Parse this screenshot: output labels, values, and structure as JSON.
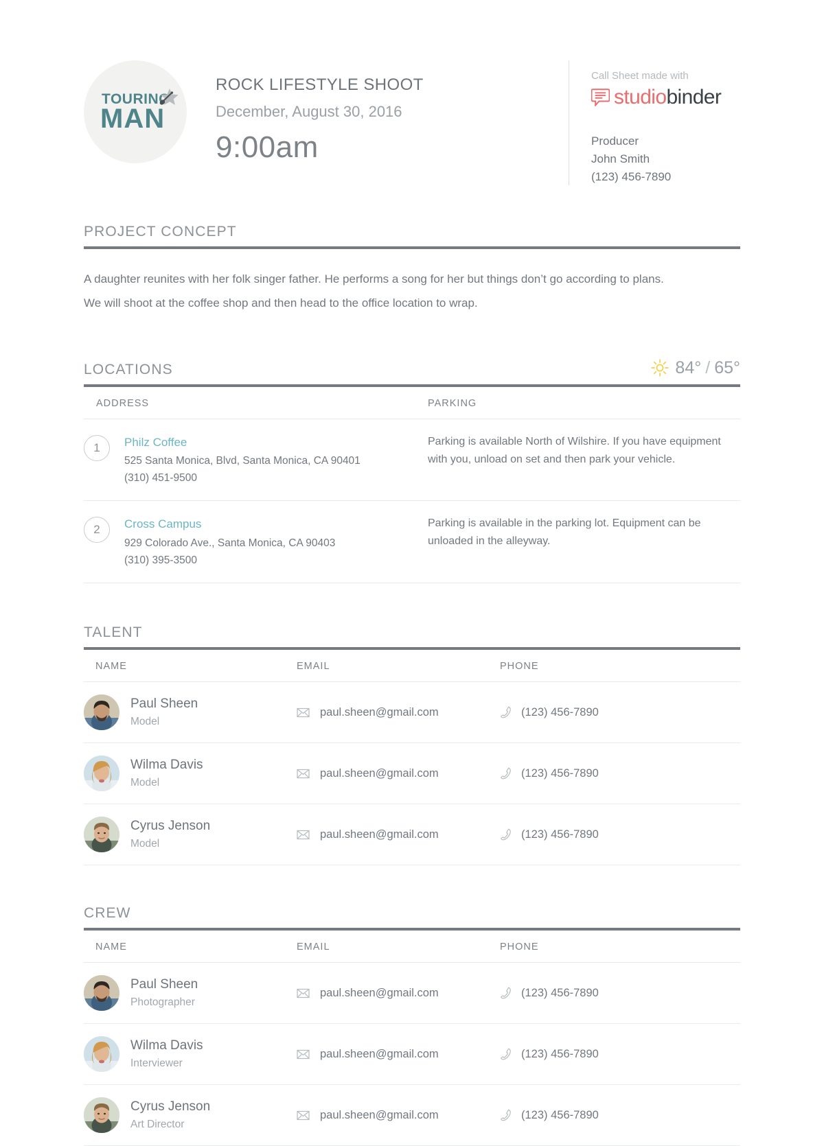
{
  "header": {
    "logo": {
      "line1": "TOURING",
      "line2": "MAN",
      "star_icon": "guitar-star-icon"
    },
    "shoot_title": "ROCK LIFESTYLE SHOOT",
    "shoot_date": "December, August 30, 2016",
    "call_time": "9:00am",
    "made_with_label": "Call Sheet made with",
    "brand": {
      "part1": "studio",
      "part2": "binder",
      "part1_color": "#ea6d6d",
      "part2_color": "#3b4045",
      "bubble_icon": "speech-bubble-icon"
    },
    "producer": {
      "role_label": "Producer",
      "name": "John Smith",
      "phone": "(123) 456-7890"
    }
  },
  "project_concept": {
    "title": "PROJECT CONCEPT",
    "lines": [
      "A daughter reunites with her folk singer father. He performs a song for her but things don’t go according to plans.",
      "We will shoot at the coffee shop and then head to the office location to wrap."
    ]
  },
  "locations": {
    "title": "LOCATIONS",
    "weather": {
      "icon": "sun-icon",
      "high": "84°",
      "separator": "/",
      "low": "65°",
      "icon_color": "#f2d14a"
    },
    "columns": [
      "ADDRESS",
      "PARKING"
    ],
    "rows": [
      {
        "number": "1",
        "name": "Philz Coffee",
        "street": "525 Santa Monica, Blvd, Santa Monica, CA 90401",
        "phone": "(310) 451-9500",
        "parking": "Parking is available North of Wilshire.  If you have equipment with you, unload on set and then park your vehicle."
      },
      {
        "number": "2",
        "name": "Cross Campus",
        "street": "929 Colorado Ave., Santa Monica, CA 90403",
        "phone": "(310) 395-3500",
        "parking": "Parking is available in the parking lot. Equipment can be unloaded in the alleyway."
      }
    ]
  },
  "talent": {
    "title": "TALENT",
    "columns": [
      "NAME",
      "EMAIL",
      "PHONE"
    ],
    "rows": [
      {
        "name": "Paul Sheen",
        "role": "Model",
        "email": "paul.sheen@gmail.com",
        "phone": "(123) 456-7890",
        "avatar": "avatar-paul-sheen"
      },
      {
        "name": "Wilma Davis",
        "role": "Model",
        "email": "paul.sheen@gmail.com",
        "phone": "(123) 456-7890",
        "avatar": "avatar-wilma-davis"
      },
      {
        "name": "Cyrus Jenson",
        "role": "Model",
        "email": "paul.sheen@gmail.com",
        "phone": "(123) 456-7890",
        "avatar": "avatar-cyrus-jenson"
      }
    ]
  },
  "crew": {
    "title": "CREW",
    "columns": [
      "NAME",
      "EMAIL",
      "PHONE"
    ],
    "rows": [
      {
        "name": "Paul Sheen",
        "role": "Photographer",
        "email": "paul.sheen@gmail.com",
        "phone": "(123) 456-7890",
        "avatar": "avatar-paul-sheen"
      },
      {
        "name": "Wilma Davis",
        "role": "Interviewer",
        "email": "paul.sheen@gmail.com",
        "phone": "(123) 456-7890",
        "avatar": "avatar-wilma-davis"
      },
      {
        "name": "Cyrus Jenson",
        "role": "Art Director",
        "email": "paul.sheen@gmail.com",
        "phone": "(123) 456-7890",
        "avatar": "avatar-cyrus-jenson"
      }
    ]
  },
  "icons": {
    "email": "envelope-icon",
    "phone": "phone-handset-icon"
  }
}
